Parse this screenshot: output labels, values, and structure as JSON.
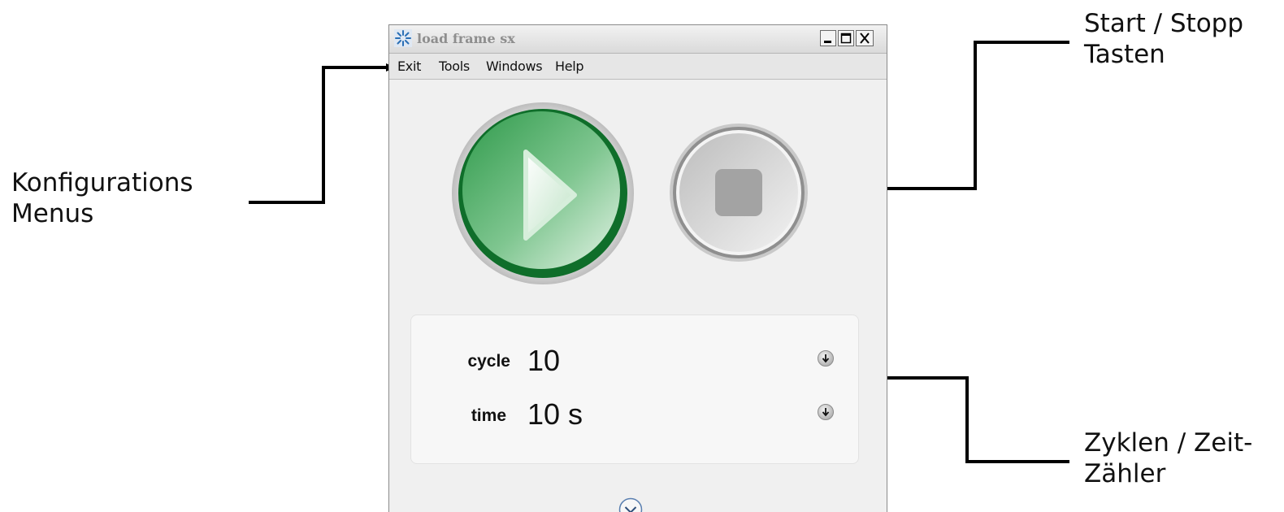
{
  "window": {
    "title": "load frame sx",
    "controls": [
      "minimize",
      "maximize",
      "close"
    ]
  },
  "menu": {
    "items": [
      {
        "label": "Exit"
      },
      {
        "label": "Tools"
      },
      {
        "label": "Windows"
      },
      {
        "label": "Help"
      }
    ]
  },
  "controls": {
    "start_icon": "play-icon",
    "stop_icon": "stop-icon",
    "start_color": "#1e8a3c",
    "stop_color": "#c8c8c8"
  },
  "counters": {
    "cycle": {
      "label": "cycle",
      "value": "10"
    },
    "time": {
      "label": "time",
      "value": "10 s"
    },
    "download_icon": "download-arrow-icon",
    "expand_icon": "chevron-down-icon"
  },
  "annotations": {
    "menus": {
      "line1": "Konfigurations",
      "line2": "Menus"
    },
    "start_stop": {
      "line1": "Start / Stopp",
      "line2": "Tasten"
    },
    "counters": {
      "line1": "Zyklen / Zeit-",
      "line2": "Zähler"
    }
  }
}
